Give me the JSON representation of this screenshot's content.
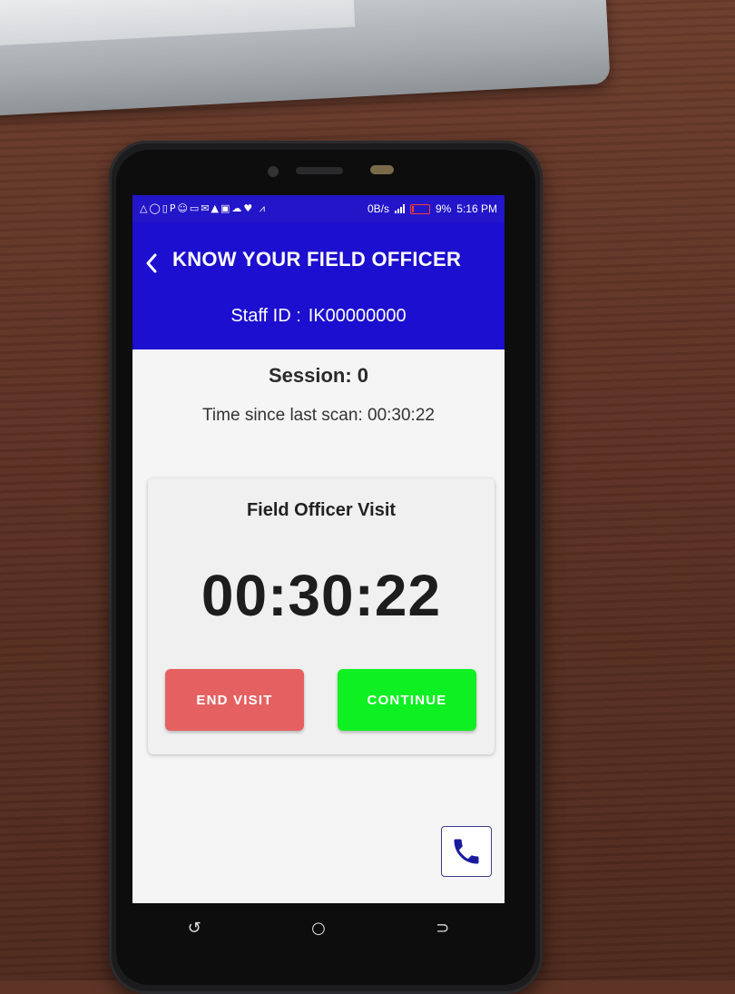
{
  "status_bar": {
    "left_icons": "△◯▯P☺▭✉▲▣☁♥ ⩘",
    "net_speed": "0B/s",
    "battery_percent": "9%",
    "time": "5:16 PM",
    "battery_color": "#ff3b30"
  },
  "app_bar": {
    "back_icon": "chevron-left-icon",
    "title": "KNOW YOUR FIELD OFFICER",
    "staff_label": "Staff ID :",
    "staff_id": "IK00000000",
    "color": "#1c0fcf"
  },
  "session": {
    "label": "Session: 0",
    "since_last_scan": "Time since last scan: 00:30:22"
  },
  "visit_card": {
    "title": "Field Officer Visit",
    "timer": "00:30:22",
    "end_button": "END VISIT",
    "continue_button": "CONTINUE",
    "end_color": "#e56161",
    "continue_color": "#0ef022"
  },
  "call_button": {
    "icon": "phone-icon"
  },
  "nav_bar": {
    "recents": "↺",
    "home": "○",
    "back": "⊃"
  }
}
